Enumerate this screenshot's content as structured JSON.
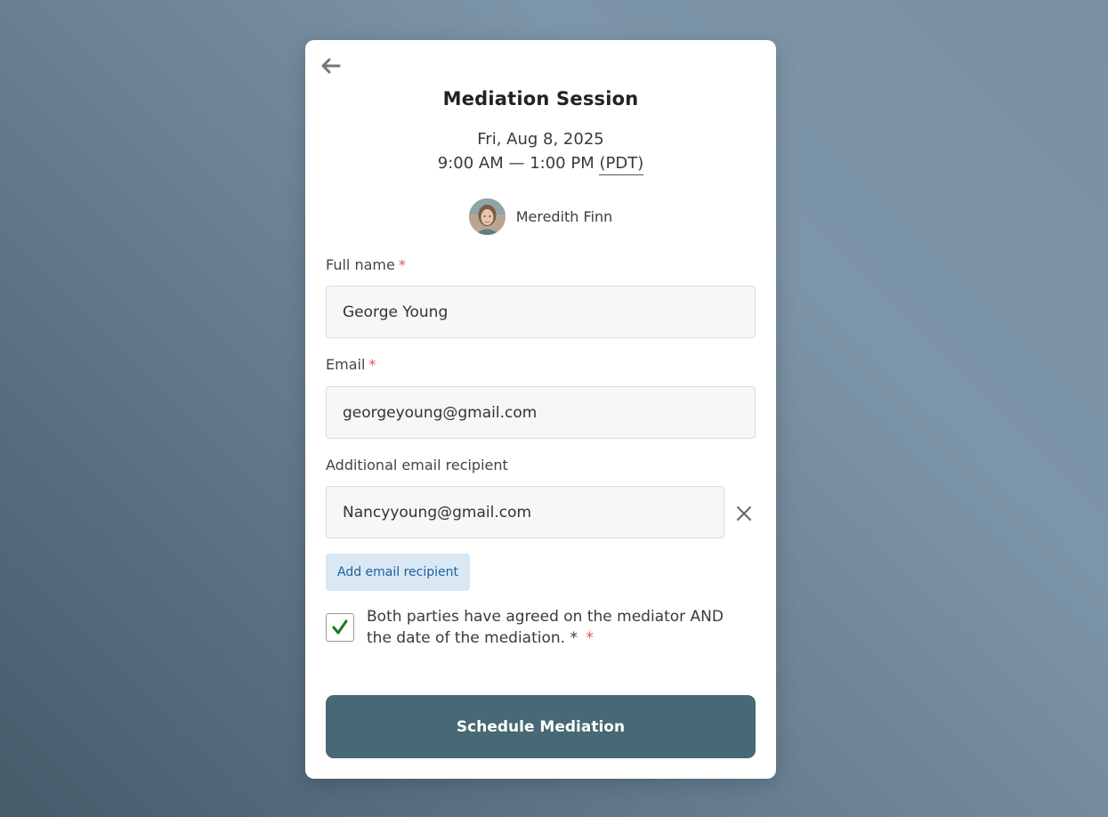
{
  "event": {
    "title": "Mediation Session",
    "date": "Fri, Aug 8, 2025",
    "time_range": "9:00 AM — 1:00 PM",
    "timezone": "(PDT)"
  },
  "host": {
    "name": "Meredith Finn"
  },
  "form": {
    "required_mark": "*",
    "full_name": {
      "label": "Full name",
      "value": "George Young"
    },
    "email": {
      "label": "Email",
      "value": "georgeyoung@gmail.com"
    },
    "additional_recipient": {
      "label": "Additional email recipient",
      "value": "Nancyyoung@gmail.com"
    },
    "add_recipient_label": "Add email recipient",
    "consent": {
      "checked": true,
      "text": "Both parties have agreed on the mediator AND the date of the mediation. *"
    },
    "submit_label": "Schedule Mediation"
  },
  "icons": {
    "back": "arrow-left-icon",
    "remove": "close-icon",
    "check": "checkmark-icon"
  },
  "colors": {
    "primary_button": "#476874",
    "secondary_button_bg": "#d8e8f4",
    "secondary_button_text": "#1f5f9a",
    "required": "#e25555",
    "checkmark": "#1a7a1a"
  }
}
